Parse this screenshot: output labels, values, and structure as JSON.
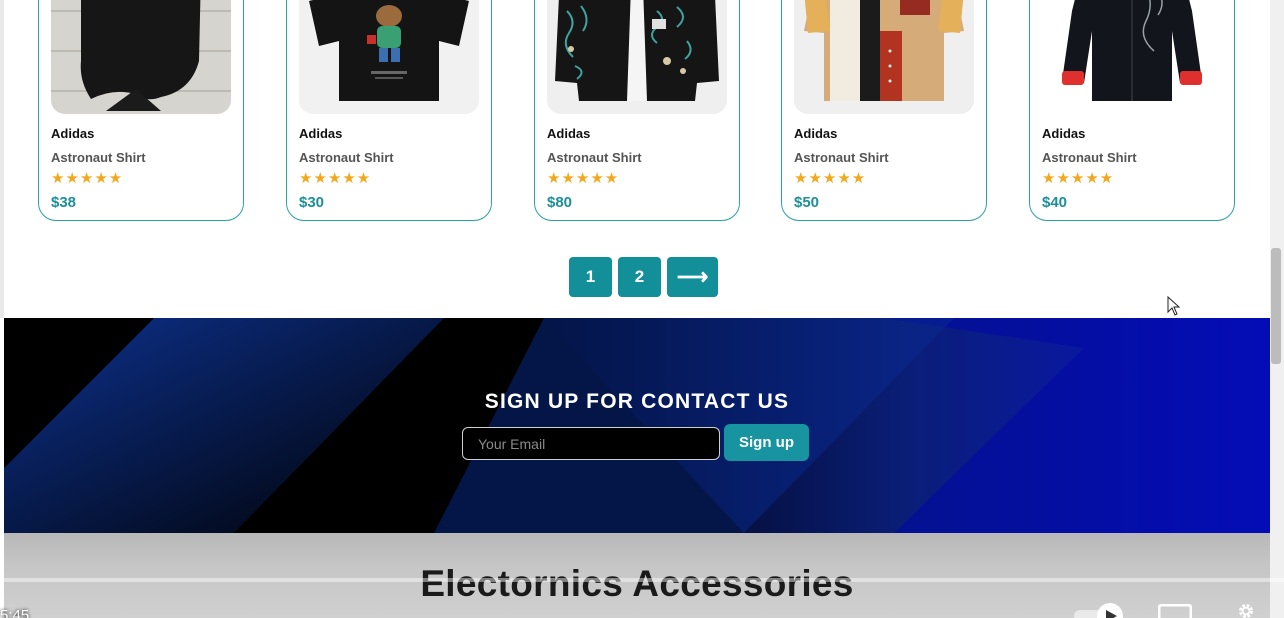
{
  "products": [
    {
      "brand": "Adidas",
      "name": "Astronaut Shirt",
      "stars": "★★★★★",
      "rating": 5,
      "price": "$38",
      "image": "black-tshirt"
    },
    {
      "brand": "Adidas",
      "name": "Astronaut Shirt",
      "stars": "★★★★★",
      "rating": 5,
      "price": "$30",
      "image": "bear-tshirt"
    },
    {
      "brand": "Adidas",
      "name": "Astronaut Shirt",
      "stars": "★★★★★",
      "rating": 5,
      "price": "$80",
      "image": "patterned-shirt"
    },
    {
      "brand": "Adidas",
      "name": "Astronaut Shirt",
      "stars": "★★★★★",
      "rating": 5,
      "price": "$50",
      "image": "colorblock-shirt"
    },
    {
      "brand": "Adidas",
      "name": "Astronaut Shirt",
      "stars": "★★★★★",
      "rating": 5,
      "price": "$40",
      "image": "black-red-shirt"
    }
  ],
  "pagination": {
    "pages": [
      "1",
      "2"
    ],
    "next": "⟶"
  },
  "signup": {
    "title": "SIGN UP FOR CONTACT US",
    "email_placeholder": "Your Email",
    "button": "Sign up"
  },
  "electronics": {
    "heading": "Electornics Accessories"
  },
  "player": {
    "time": "5:45"
  },
  "colors": {
    "accent": "#128f98",
    "card_border": "#2aa3a3",
    "price": "#1d8f99",
    "star": "#f2a81d"
  }
}
